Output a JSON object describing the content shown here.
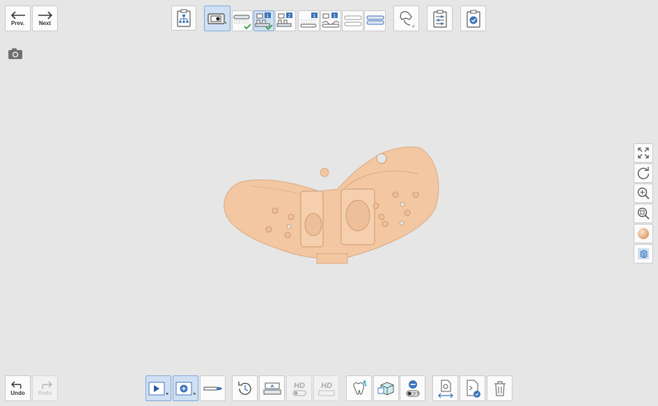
{
  "nav": {
    "prev_label": "Prev.",
    "next_label": "Next"
  },
  "history": {
    "undo_label": "Undo",
    "redo_label": "Redo"
  },
  "stage_toolbar": {
    "badges": [
      "1",
      "2",
      "1",
      "1"
    ]
  },
  "bottom_toolbar": {
    "hd_label_1": "HD",
    "hd_label_2": "HD",
    "toggle_off_label": "OFF"
  },
  "colors": {
    "background": "#e6e6e6",
    "model": "#f2c7a2",
    "accent_blue": "#3b73b9",
    "check_green": "#3aa84a"
  },
  "icons": [
    "arrow-left-icon",
    "arrow-right-icon",
    "camera-icon",
    "workflow-icon",
    "scan-icon",
    "fit-screen-icon",
    "rotate-icon",
    "zoom-in-icon",
    "zoom-fit-icon",
    "color-ball-icon",
    "cube-view-icon",
    "undo-icon",
    "redo-icon",
    "trash-icon"
  ]
}
